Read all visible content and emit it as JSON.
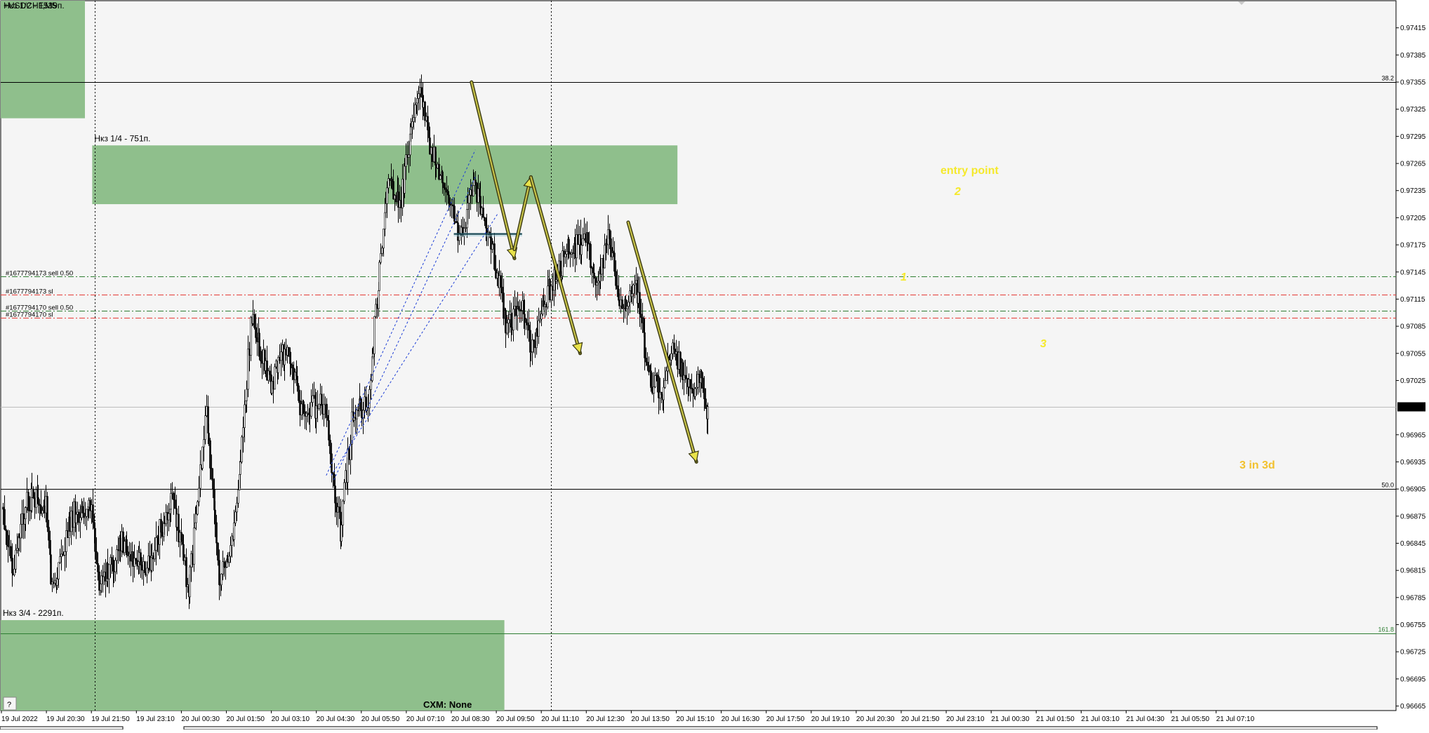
{
  "chart_data": {
    "type": "candlestick",
    "symbol_label": "+USDCHF,M5",
    "price_range": [
      0.9666,
      0.97445
    ],
    "price_ticks": [
      "0.97415",
      "0.97385",
      "0.97355",
      "0.97325",
      "0.97295",
      "0.97265",
      "0.97235",
      "0.97205",
      "0.97175",
      "0.97145",
      "0.97115",
      "0.97085",
      "0.97055",
      "0.97025",
      "0.96965",
      "0.96935",
      "0.96905",
      "0.96875",
      "0.96845",
      "0.96815",
      "0.96785",
      "0.96755",
      "0.96725",
      "0.96695",
      "0.96665"
    ],
    "current_price": "0.96996",
    "time_labels": [
      "19 Jul 2022",
      "19 Jul 20:30",
      "19 Jul 21:50",
      "19 Jul 23:10",
      "20 Jul 00:30",
      "20 Jul 01:50",
      "20 Jul 03:10",
      "20 Jul 04:30",
      "20 Jul 05:50",
      "20 Jul 07:10",
      "20 Jul 08:30",
      "20 Jul 09:50",
      "20 Jul 11:10",
      "20 Jul 12:30",
      "20 Jul 13:50",
      "20 Jul 15:10",
      "20 Jul 16:30",
      "20 Jul 17:50",
      "20 Jul 19:10",
      "20 Jul 20:30",
      "20 Jul 21:50",
      "20 Jul 23:10",
      "21 Jul 00:30",
      "21 Jul 01:50",
      "21 Jul 03:10",
      "21 Jul 04:30",
      "21 Jul 05:50",
      "21 Jul 07:10"
    ],
    "price_path": [
      {
        "t": 0,
        "p": 0.96885
      },
      {
        "t": 8,
        "p": 0.96815
      },
      {
        "t": 20,
        "p": 0.96895
      },
      {
        "t": 35,
        "p": 0.96885
      },
      {
        "t": 40,
        "p": 0.96795
      },
      {
        "t": 55,
        "p": 0.96875
      },
      {
        "t": 70,
        "p": 0.9689
      },
      {
        "t": 78,
        "p": 0.96795
      },
      {
        "t": 95,
        "p": 0.96845
      },
      {
        "t": 115,
        "p": 0.96815
      },
      {
        "t": 135,
        "p": 0.969
      },
      {
        "t": 148,
        "p": 0.9679
      },
      {
        "t": 162,
        "p": 0.97
      },
      {
        "t": 172,
        "p": 0.968
      },
      {
        "t": 185,
        "p": 0.9687
      },
      {
        "t": 198,
        "p": 0.971
      },
      {
        "t": 212,
        "p": 0.9702
      },
      {
        "t": 225,
        "p": 0.9706
      },
      {
        "t": 238,
        "p": 0.9699
      },
      {
        "t": 255,
        "p": 0.97
      },
      {
        "t": 268,
        "p": 0.9686
      },
      {
        "t": 278,
        "p": 0.9699
      },
      {
        "t": 290,
        "p": 0.97
      },
      {
        "t": 305,
        "p": 0.9725
      },
      {
        "t": 315,
        "p": 0.9722
      },
      {
        "t": 330,
        "p": 0.9735
      },
      {
        "t": 340,
        "p": 0.9728
      },
      {
        "t": 352,
        "p": 0.9723
      },
      {
        "t": 362,
        "p": 0.9718
      },
      {
        "t": 374,
        "p": 0.9724
      },
      {
        "t": 382,
        "p": 0.972
      },
      {
        "t": 390,
        "p": 0.9716
      },
      {
        "t": 400,
        "p": 0.9708
      },
      {
        "t": 410,
        "p": 0.9711
      },
      {
        "t": 420,
        "p": 0.9706
      },
      {
        "t": 432,
        "p": 0.9712
      },
      {
        "t": 448,
        "p": 0.9717
      },
      {
        "t": 462,
        "p": 0.9718
      },
      {
        "t": 472,
        "p": 0.9713
      },
      {
        "t": 480,
        "p": 0.9718
      },
      {
        "t": 492,
        "p": 0.971
      },
      {
        "t": 502,
        "p": 0.9713
      },
      {
        "t": 512,
        "p": 0.9703
      },
      {
        "t": 522,
        "p": 0.9701
      },
      {
        "t": 530,
        "p": 0.9706
      },
      {
        "t": 538,
        "p": 0.9704
      },
      {
        "t": 548,
        "p": 0.9701
      },
      {
        "t": 554,
        "p": 0.9703
      },
      {
        "t": 558,
        "p": 0.9699
      }
    ],
    "candle_count": 559,
    "demand_zones": [
      {
        "label": "Нкз 1/2 - 1539п.",
        "price_top": 0.97445,
        "price_bottom": 0.97315,
        "t_start": 0,
        "t_end": 65
      },
      {
        "label": "Нкз 1/4 - 751п.",
        "price_top": 0.97285,
        "price_bottom": 0.9722,
        "t_start": 73,
        "t_end": 534
      },
      {
        "label": "Нкз 3/4 - 2291п.",
        "price_top": 0.9676,
        "price_bottom": 0.9666,
        "t_start": 0,
        "t_end": 397
      }
    ],
    "order_lines": [
      {
        "label": "#1677794173 sell 0.50",
        "price": 0.9714,
        "kind": "entry"
      },
      {
        "label": "#1677794173 sl",
        "price": 0.9712,
        "kind": "sl"
      },
      {
        "label": "#1677794170 sell 0.50",
        "price": 0.97102,
        "kind": "entry"
      },
      {
        "label": "#1677794170 sl",
        "price": 0.97094,
        "kind": "sl"
      }
    ],
    "fib_levels": [
      {
        "label": "38.2",
        "price": 0.97355
      },
      {
        "label": "50.0",
        "price": 0.96905
      },
      {
        "label": "161.8",
        "price": 0.96745
      }
    ],
    "support_line": {
      "price": 0.97187,
      "t_start": 357,
      "t_end": 411
    },
    "annotations": {
      "entry_point": "entry point",
      "wave_1": "1",
      "wave_2": "2",
      "wave_3": "3",
      "target": "3 in 3d"
    },
    "arrows": [
      {
        "from_t": 371,
        "from_p": 0.97355,
        "to_t": 405,
        "to_p": 0.9716
      },
      {
        "from_t": 405,
        "from_p": 0.9717,
        "to_t": 418,
        "to_p": 0.9725
      },
      {
        "from_t": 418,
        "from_p": 0.9725,
        "to_t": 457,
        "to_p": 0.97055
      },
      {
        "from_t": 495,
        "from_p": 0.972,
        "to_t": 549,
        "to_p": 0.96935
      }
    ],
    "session_separators_t": [
      73,
      434
    ],
    "broker_label": "CXM: None",
    "help_button": "?"
  }
}
